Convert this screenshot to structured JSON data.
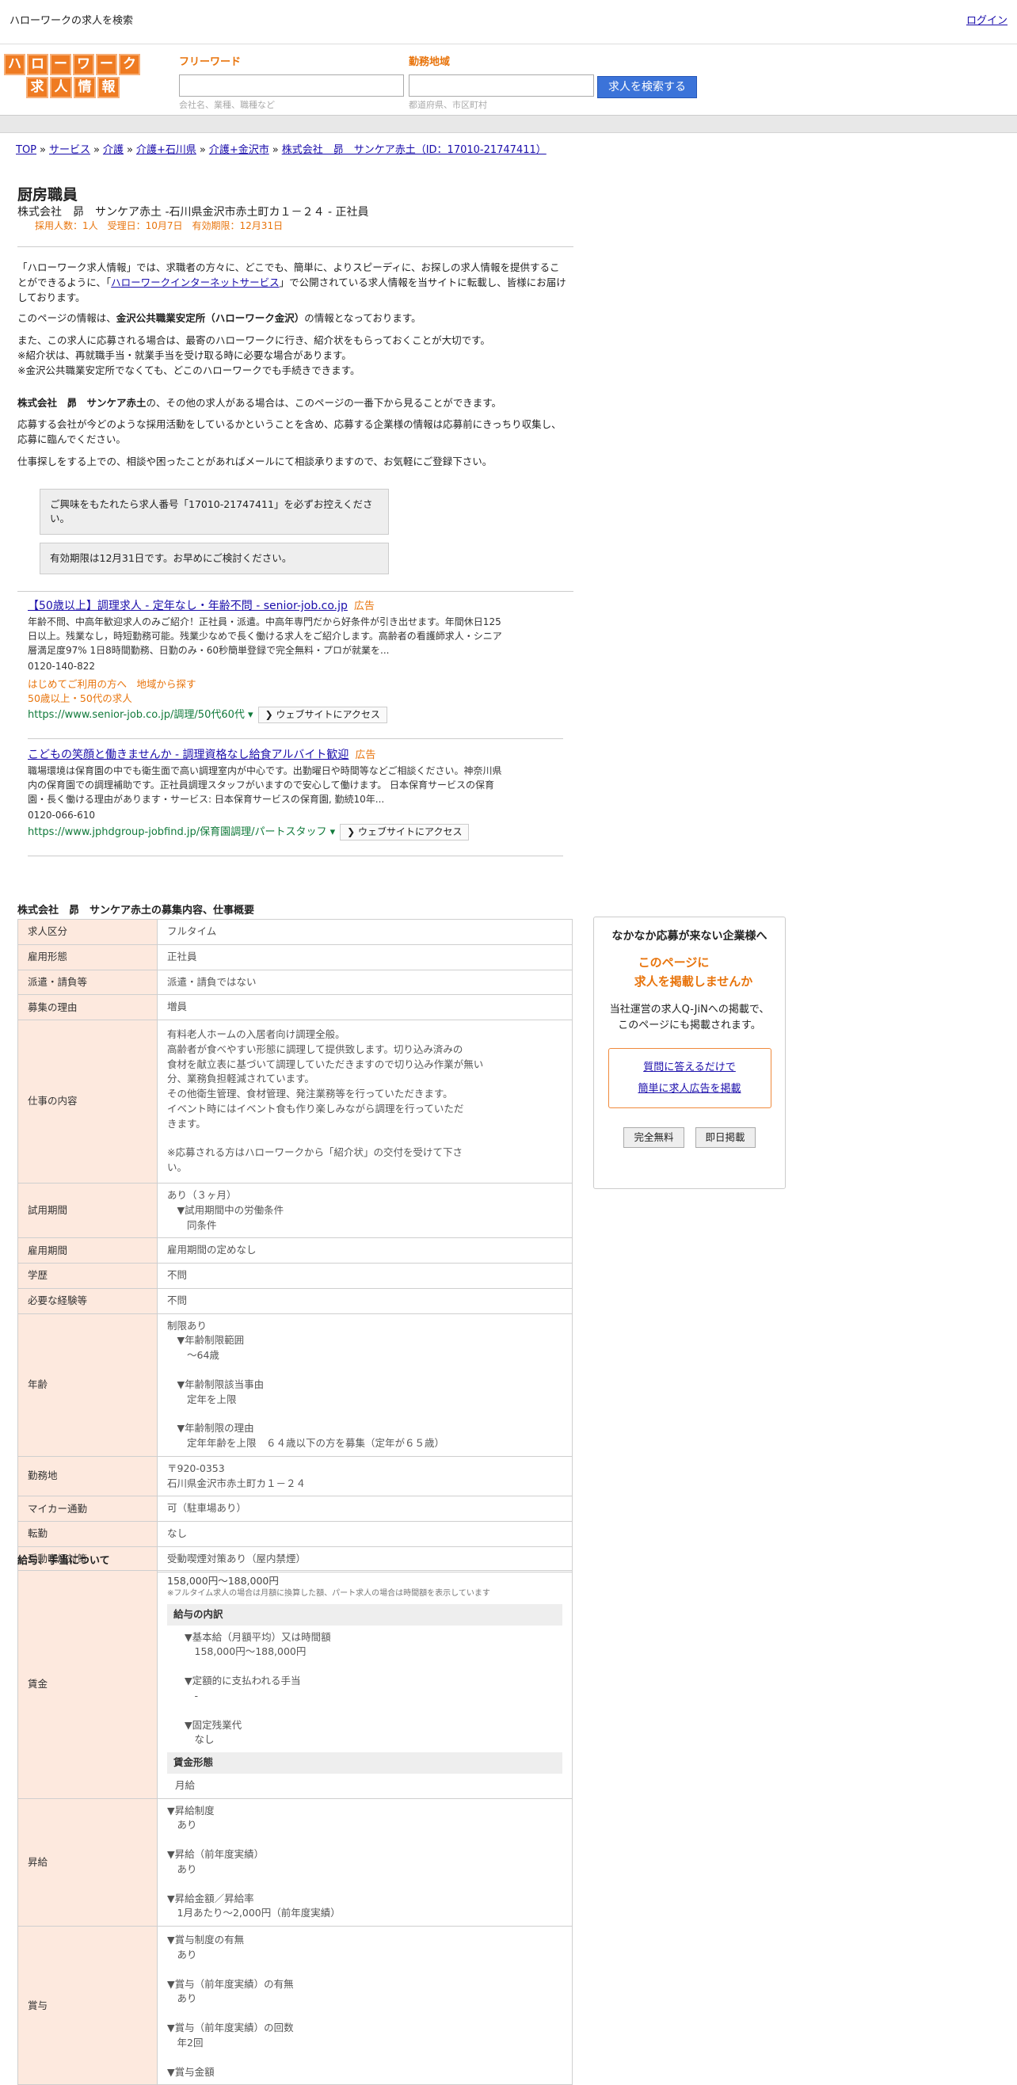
{
  "topbar": {
    "title": "ハローワークの求人を検索",
    "login": "ログイン"
  },
  "logo": {
    "row1": [
      "ハ",
      "ロ",
      "ー",
      "ワ",
      "ー",
      "ク"
    ],
    "row2": [
      "求",
      "人",
      "情",
      "報"
    ]
  },
  "search": {
    "free_label": "フリーワード",
    "free_placeholder": "会社名、業種、職種など",
    "area_label": "勤務地域",
    "area_placeholder": "都道府県、市区町村",
    "button": "求人を検索する"
  },
  "breadcrumb": [
    "TOP",
    "サービス",
    "介護",
    "介護+石川県",
    "介護+金沢市",
    "株式会社　昴　サンケア赤土（ID：17010-21747411）"
  ],
  "job": {
    "title": "厨房職員",
    "subtitle": "株式会社　昴　サンケア赤土 -石川県金沢市赤土町カ１－２４ - 正社員",
    "meta": "採用人数：1人　受理日：10月7日　有効期限：12月31日"
  },
  "intro": {
    "p1_a": "「ハローワーク求人情報」では、求職者の方々に、どこでも、簡単に、よりスピーディに、お探しの求人情報を提供することができるように、「",
    "p1_link": "ハローワークインターネットサービス",
    "p1_b": "」で公開されている求人情報を当サイトに転載し、皆様にお届けしております。",
    "p2_a": "このページの情報は、",
    "p2_bold": "金沢公共職業安定所（ハローワーク金沢）",
    "p2_b": "の情報となっております。",
    "p3": [
      "また、この求人に応募される場合は、最寄のハローワークに行き、紹介状をもらっておくことが大切です。",
      "※紹介状は、再就職手当・就業手当を受け取る時に必要な場合があります。",
      "※金沢公共職業安定所でなくても、どこのハローワークでも手続きできます。"
    ],
    "p4_bold": "株式会社　昴　サンケア赤土",
    "p4": "の、その他の求人がある場合は、このページの一番下から見ることができます。",
    "p5": "応募する会社が今どのような採用活動をしているかということを含め、応募する企業様の情報は応募前にきっちり収集し、応募に臨んでください。",
    "p6": "仕事探しをする上での、相談や困ったことがあればメールにて相談承りますので、お気軽にご登録下さい。"
  },
  "notes": {
    "n1": "ご興味をもたれたら求人番号「17010-21747411」を必ずお控えください。",
    "n2": "有効期限は12月31日です。お早めにご検討ください。"
  },
  "ads": [
    {
      "title": "【50歳以上】調理求人 - 定年なし・年齢不問 - senior-job.co.jp",
      "tag": "広告",
      "desc": "年齢不問、中高年歓迎求人のみご紹介！正社員・派遣。中高年専門だから好条件が引き出せます。年間休日125日以上。残業なし，時短勤務可能。残業少なめで長く働ける求人をご紹介します。高齢者の看護師求人・シニア層満足度97% 1日8時間勤務、日勤のみ・60秒簡単登録で完全無料・プロが就業を...",
      "phone": "0120-140-822",
      "links": [
        "はじめてご利用の方へ",
        "地域から探す",
        "50歳以上・50代の求人"
      ],
      "url": "https://www.senior-job.co.jp/調理/50代60代",
      "visit": "ウェブサイトにアクセス"
    },
    {
      "title": "こどもの笑顔と働きませんか - 調理資格なし給食アルバイト歓迎",
      "tag": "広告",
      "desc": "職場環境は保育園の中でも衛生面で高い調理室内が中心です。出勤曜日や時間等などご相談ください。神奈川県内の保育園での調理補助です。正社員調理スタッフがいますので安心して働けます。 日本保育サービスの保育園・長く働ける理由があります・サービス: 日本保育サービスの保育園, 勤続10年...",
      "phone": "0120-066-610",
      "url": "https://www.jphdgroup-jobfind.jp/保育園調理/パートスタッフ",
      "visit": "ウェブサイトにアクセス"
    }
  ],
  "section1": {
    "heading": "株式会社　昴　サンケア赤土の募集内容、仕事概要",
    "rows": [
      {
        "k": "求人区分",
        "v": [
          "フルタイム"
        ]
      },
      {
        "k": "雇用形態",
        "v": [
          "正社員"
        ]
      },
      {
        "k": "派遣・請負等",
        "v": [
          "派遣・請負ではない"
        ]
      },
      {
        "k": "募集の理由",
        "v": [
          "増員"
        ]
      },
      {
        "k": "仕事の内容",
        "v": [
          "有料老人ホームの入居者向け調理全般。",
          "高齢者が食べやすい形態に調理して提供致します。切り込み済みの",
          "食材を献立表に基づいて調理していただきますので切り込み作業が無い",
          "分、業務負担軽減されています。",
          "その他衛生管理、食材管理、発注業務等を行っていただきます。",
          "イベント時にはイベント食も作り楽しみながら調理を行っていただ",
          "きます。",
          "",
          "※応募される方はハローワークから「紹介状」の交付を受けて下さ",
          "い。"
        ]
      },
      {
        "k": "試用期間",
        "v": [
          "あり（３ヶ月）",
          "　▼試用期間中の労働条件",
          "　　同条件"
        ]
      },
      {
        "k": "雇用期間",
        "v": [
          "雇用期間の定めなし"
        ]
      },
      {
        "k": "学歴",
        "v": [
          "不問"
        ]
      },
      {
        "k": "必要な経験等",
        "v": [
          "不問"
        ]
      },
      {
        "k": "年齢",
        "v": [
          "制限あり",
          "　▼年齢制限範囲",
          "　　〜64歳",
          "",
          "　▼年齢制限該当事由",
          "　　定年を上限",
          "",
          "　▼年齢制限の理由",
          "　　定年年齢を上限　６４歳以下の方を募集（定年が６５歳）"
        ]
      },
      {
        "k": "勤務地",
        "v": [
          "〒920-0353",
          "石川県金沢市赤土町カ１－２４"
        ]
      },
      {
        "k": "マイカー通勤",
        "v": [
          "可（駐車場あり）"
        ]
      },
      {
        "k": "転勤",
        "v": [
          "なし"
        ]
      },
      {
        "k": "受動喫煙対策",
        "v": [
          "受動喫煙対策あり（屋内禁煙）"
        ]
      }
    ]
  },
  "section2": {
    "heading": "給与、手当について",
    "wage_label": "賃金",
    "wage_range": "158,000円〜188,000円",
    "wage_note": "※フルタイム求人の場合は月額に換算した額、パート求人の場合は時間額を表示しています",
    "breakdown_head": "給与の内訳",
    "breakdown": [
      "▼基本給（月額平均）又は時間額",
      "　158,000円〜188,000円",
      "",
      "▼定額的に支払われる手当",
      "　-",
      "",
      "▼固定残業代",
      "　なし"
    ],
    "form_head": "賃金形態",
    "form": "月給",
    "raise_label": "昇給",
    "raise": [
      "▼昇給制度",
      "　あり",
      "",
      "▼昇給（前年度実績）",
      "　あり",
      "",
      "▼昇給金額／昇給率",
      "　1月あたり〜2,000円（前年度実績）"
    ],
    "bonus_label": "賞与",
    "bonus": [
      "▼賞与制度の有無",
      "　あり",
      "",
      "▼賞与（前年度実績）の有無",
      "　あり",
      "",
      "▼賞与（前年度実績）の回数",
      "　年2回",
      "",
      "▼賞与金額"
    ]
  },
  "sidebar": {
    "heading": "なかなか応募が来ない企業様へ",
    "orange1": "このページに",
    "orange2": "求人を掲載しませんか",
    "p1": "当社運営の求人Q-JiNへの掲載で、",
    "p2": "このページにも掲載されます。",
    "link1": "質問に答えるだけで",
    "link2": "簡単に求人広告を掲載",
    "btn1": "完全無料",
    "btn2": "即日掲載"
  }
}
